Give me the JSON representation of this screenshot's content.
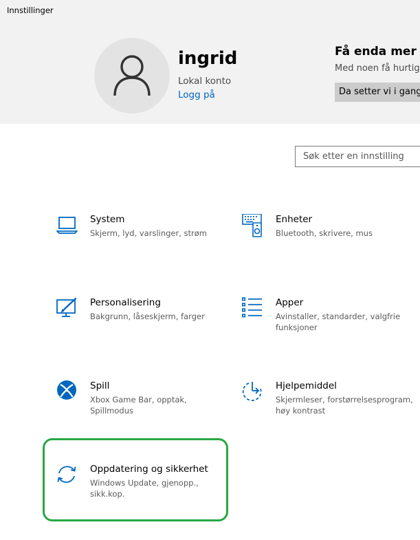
{
  "window": {
    "title": "Innstillinger"
  },
  "profile": {
    "name": "ingrid",
    "account_type": "Lokal konto",
    "sign_in_link": "Logg på"
  },
  "promo": {
    "title": "Få enda mer u",
    "text": "Med noen få hurtigv",
    "button": "Da setter vi i gang!"
  },
  "search": {
    "placeholder": "Søk etter en innstilling"
  },
  "categories": [
    {
      "name": "System",
      "desc": "Skjerm, lyd, varslinger, strøm",
      "icon": "laptop-icon"
    },
    {
      "name": "Enheter",
      "desc": "Bluetooth, skrivere, mus",
      "icon": "devices-icon"
    },
    {
      "name": "Personalisering",
      "desc": "Bakgrunn, låseskjerm, farger",
      "icon": "personalization-icon"
    },
    {
      "name": "Apper",
      "desc": "Avinstaller, standarder, valgfrie funksjoner",
      "icon": "apps-list-icon"
    },
    {
      "name": "Spill",
      "desc": "Xbox Game Bar, opptak, Spillmodus",
      "icon": "xbox-icon"
    },
    {
      "name": "Hjelpemiddel",
      "desc": "Skjermleser, forstørrelsesprogram, høy kontrast",
      "icon": "ease-of-access-icon"
    },
    {
      "name": "Oppdatering og sikkerhet",
      "desc": "Windows Update, gjenopp., sikk.kop.",
      "icon": "update-sync-icon"
    }
  ],
  "colors": {
    "accent": "#0067c0",
    "header_bg": "#f2f2f2",
    "highlight_border": "#28a745"
  }
}
